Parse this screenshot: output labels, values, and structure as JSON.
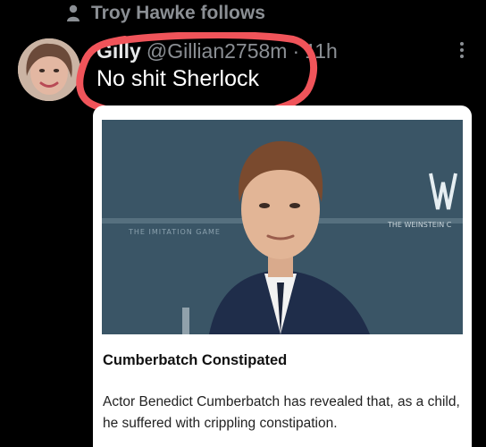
{
  "social_context": {
    "icon": "person-icon",
    "text": "Troy Hawke follows"
  },
  "tweet": {
    "display_name": "Gilly",
    "handle": "@Gillian2758m",
    "separator": "·",
    "time": "11h",
    "text": "No shit Sherlock"
  },
  "card": {
    "title": "Cumberbatch Constipated",
    "description": "Actor Benedict Cumberbatch has revealed that, as a child, he suffered with crippling constipation."
  },
  "colors": {
    "background": "#000000",
    "secondary_text": "#8b8f94",
    "annotation_red": "#f0545a",
    "card_background": "#ffffff"
  }
}
